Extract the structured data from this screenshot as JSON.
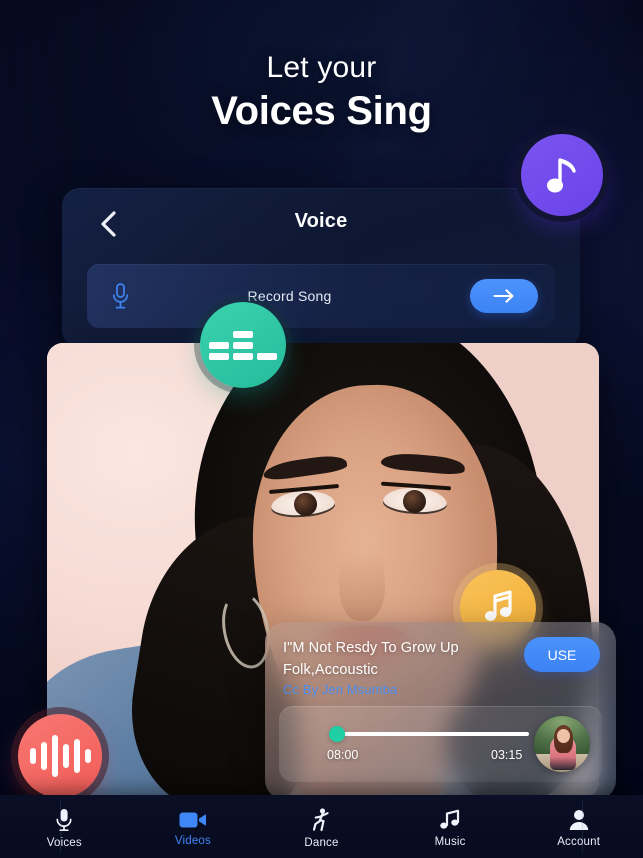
{
  "headline": {
    "line1": "Let your",
    "line2": "Voices Sing"
  },
  "voice_card": {
    "back_icon": "chevron-left-icon",
    "title": "Voice",
    "record_field": {
      "mic_icon": "microphone-icon",
      "placeholder": "Record Song",
      "value": "Record Song",
      "submit_icon": "arrow-right-icon"
    }
  },
  "badges": [
    {
      "name": "music-note-badge",
      "icon": "music-note-icon",
      "color": "#6a43e8"
    },
    {
      "name": "equalizer-badge",
      "icon": "equalizer-icon",
      "color": "#25bb9c"
    },
    {
      "name": "double-music-note-badge",
      "icon": "double-music-note-icon",
      "color": "#f2ae36"
    },
    {
      "name": "waveform-badge",
      "icon": "waveform-icon",
      "color": "#f25c58"
    }
  ],
  "photo": {
    "alt": "portrait-photo",
    "backdrop_color": "#f6dbd4"
  },
  "song_panel": {
    "title": "I\"M Not Resdy To Grow Up",
    "genre": "Folk,Accoustic",
    "credit": "Cc By Jen Msumba",
    "use_label": "USE",
    "player": {
      "time_start": "08:00",
      "time_end": "03:15",
      "progress_percent": 8,
      "thumb_color": "#21cfa4",
      "avatar": "song-artist-avatar"
    }
  },
  "bottom_nav": {
    "active_index": 1,
    "active_color": "#3f86f7",
    "items": [
      {
        "label": "Voices",
        "icon": "microphone-icon"
      },
      {
        "label": "Videos",
        "icon": "video-camera-icon"
      },
      {
        "label": "Dance",
        "icon": "dancer-icon"
      },
      {
        "label": "Music",
        "icon": "music-note-icon"
      },
      {
        "label": "Account",
        "icon": "person-icon"
      }
    ]
  }
}
